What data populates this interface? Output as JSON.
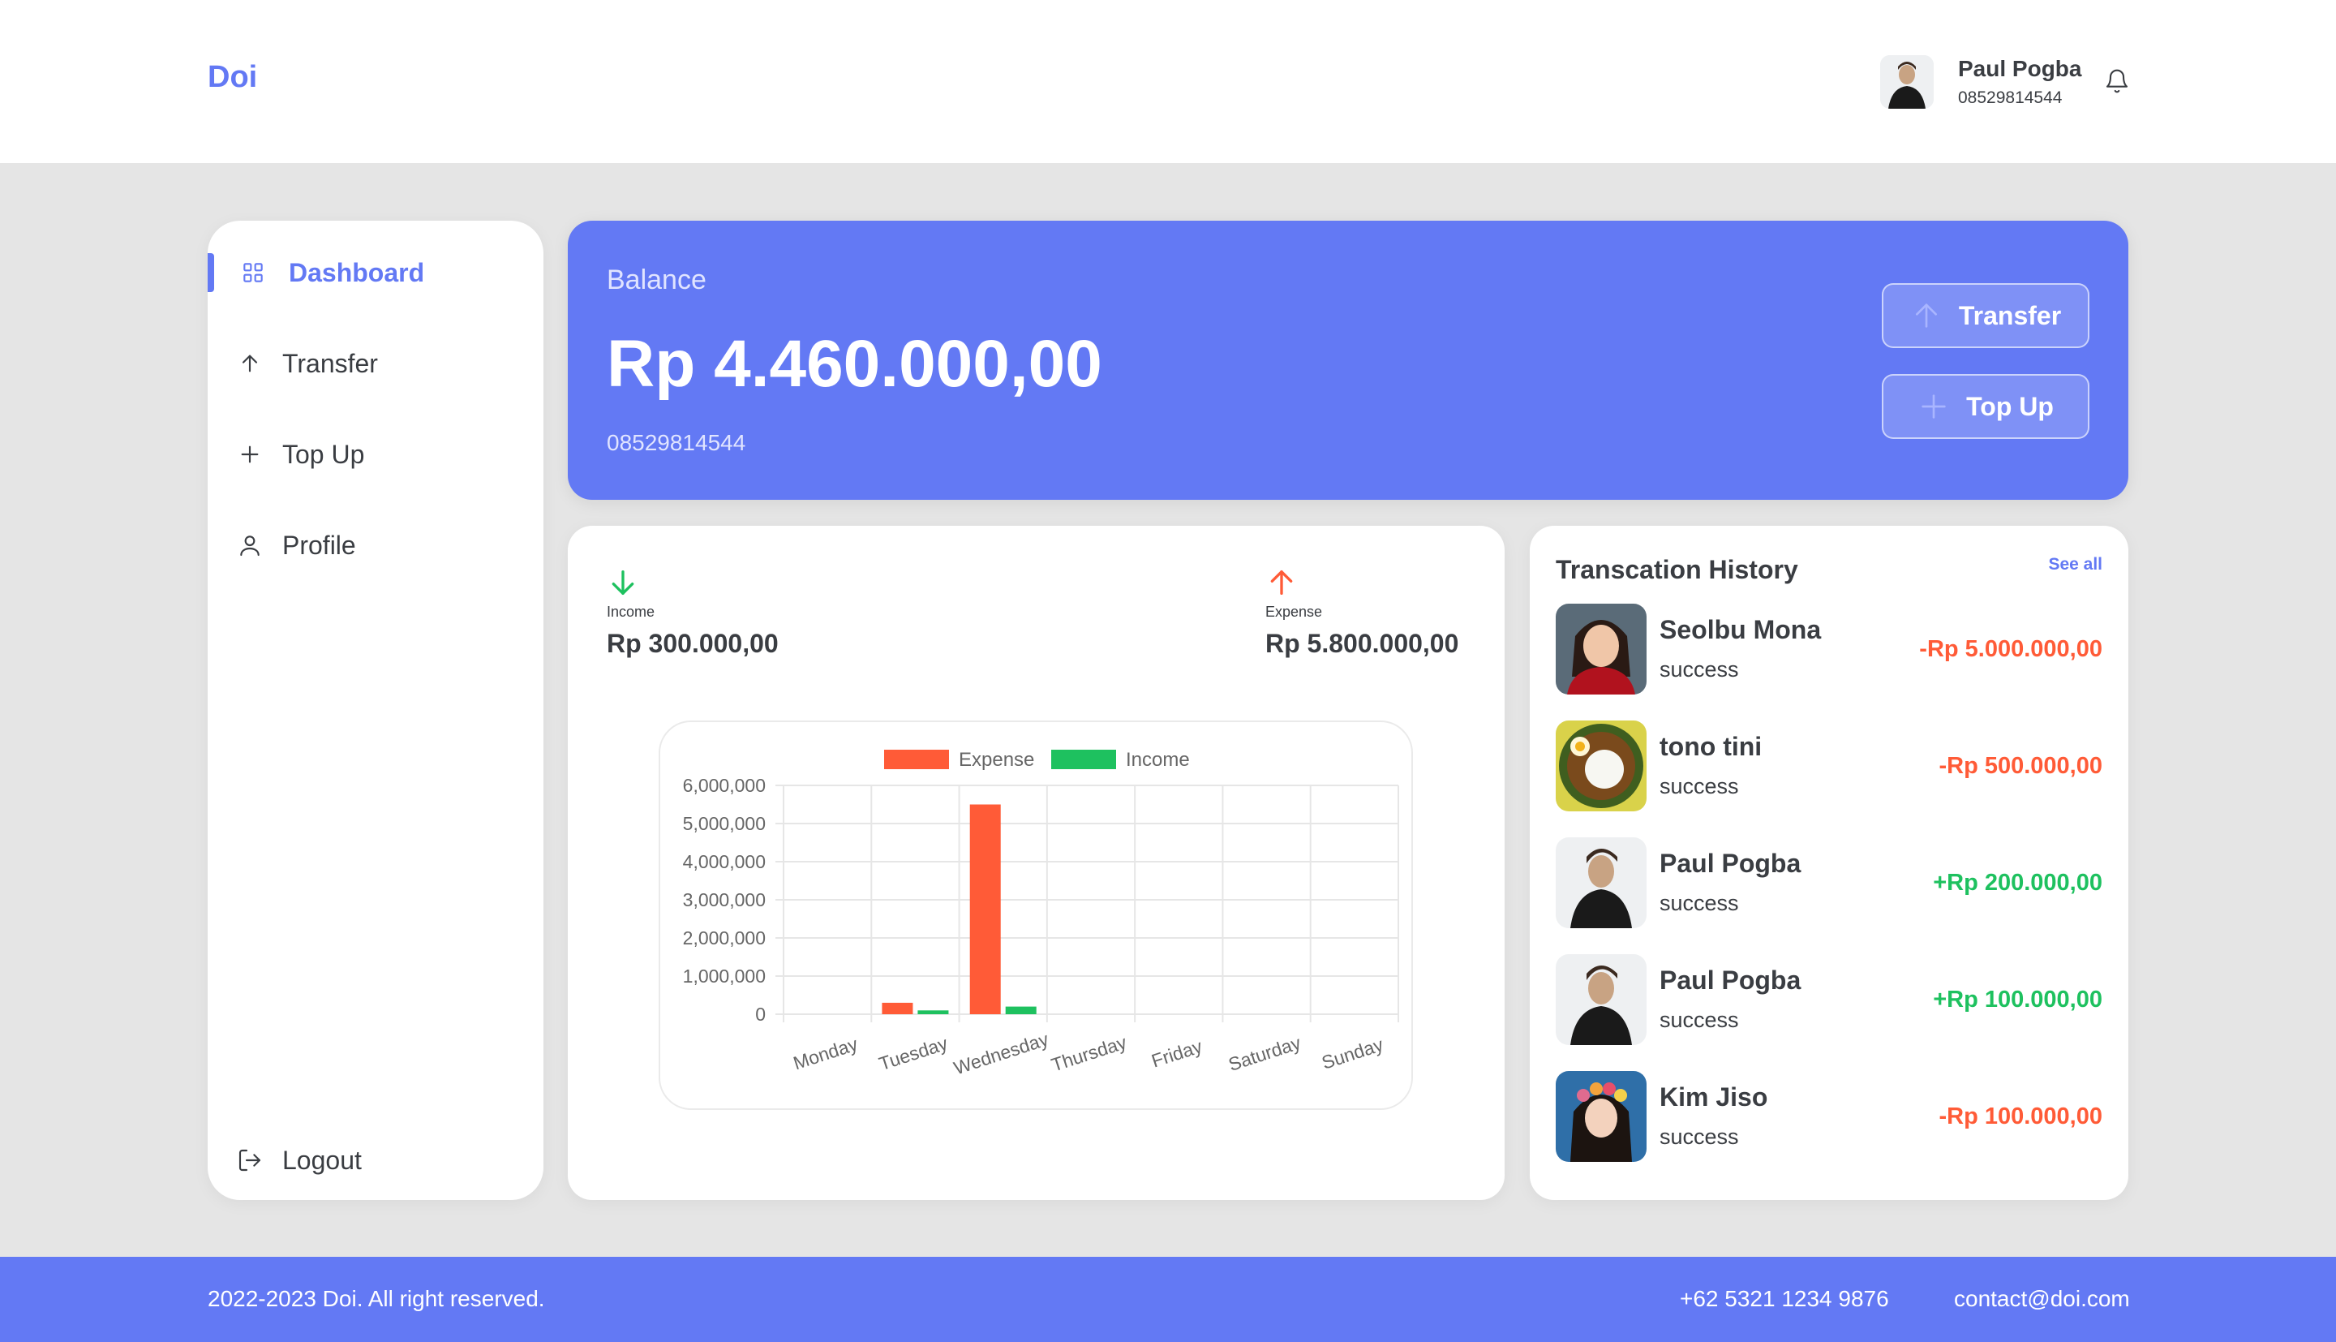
{
  "brand": "Doi",
  "user": {
    "name": "Paul Pogba",
    "phone": "08529814544"
  },
  "sidebar": {
    "items": [
      {
        "label": "Dashboard",
        "icon": "grid-icon"
      },
      {
        "label": "Transfer",
        "icon": "arrow-up-icon"
      },
      {
        "label": "Top Up",
        "icon": "plus-icon"
      },
      {
        "label": "Profile",
        "icon": "user-icon"
      }
    ],
    "logout": "Logout"
  },
  "balance": {
    "label": "Balance",
    "amount": "Rp 4.460.000,00",
    "phone": "08529814544",
    "transfer_label": "Transfer",
    "topup_label": "Top Up"
  },
  "summary": {
    "income_label": "Income",
    "income_value": "Rp 300.000,00",
    "expense_label": "Expense",
    "expense_value": "Rp 5.800.000,00"
  },
  "chart_data": {
    "type": "bar",
    "categories": [
      "Monday",
      "Tuesday",
      "Wednesday",
      "Thursday",
      "Friday",
      "Saturday",
      "Sunday"
    ],
    "series": [
      {
        "name": "Expense",
        "color": "#ff5b37",
        "values": [
          0,
          300000,
          5500000,
          0,
          0,
          0,
          0
        ]
      },
      {
        "name": "Income",
        "color": "#1ec15f",
        "values": [
          0,
          100000,
          200000,
          0,
          0,
          0,
          0
        ]
      }
    ],
    "ylim": [
      0,
      6000000
    ],
    "yticks": [
      "6,000,000",
      "5,000,000",
      "4,000,000",
      "3,000,000",
      "2,000,000",
      "1,000,000",
      "0"
    ],
    "legend": "top",
    "grid": true
  },
  "transactions": {
    "title": "Transcation History",
    "see_all": "See all",
    "items": [
      {
        "name": "Seolbu Mona",
        "status": "success",
        "amount": "-Rp 5.000.000,00",
        "color": "#ff5b37"
      },
      {
        "name": "tono tini",
        "status": "success",
        "amount": "-Rp 500.000,00",
        "color": "#ff5b37"
      },
      {
        "name": "Paul Pogba",
        "status": "success",
        "amount": "+Rp 200.000,00",
        "color": "#1ec15f"
      },
      {
        "name": "Paul Pogba",
        "status": "success",
        "amount": "+Rp 100.000,00",
        "color": "#1ec15f"
      },
      {
        "name": "Kim Jiso",
        "status": "success",
        "amount": "-Rp 100.000,00",
        "color": "#ff5b37"
      }
    ]
  },
  "footer": {
    "copyright": "2022-2023 Doi. All right reserved.",
    "phone": "+62 5321 1234 9876",
    "email": "contact@doi.com"
  },
  "colors": {
    "primary": "#6379f4",
    "expense": "#ff5b37",
    "income": "#1ec15f",
    "text": "#3a3d42"
  }
}
